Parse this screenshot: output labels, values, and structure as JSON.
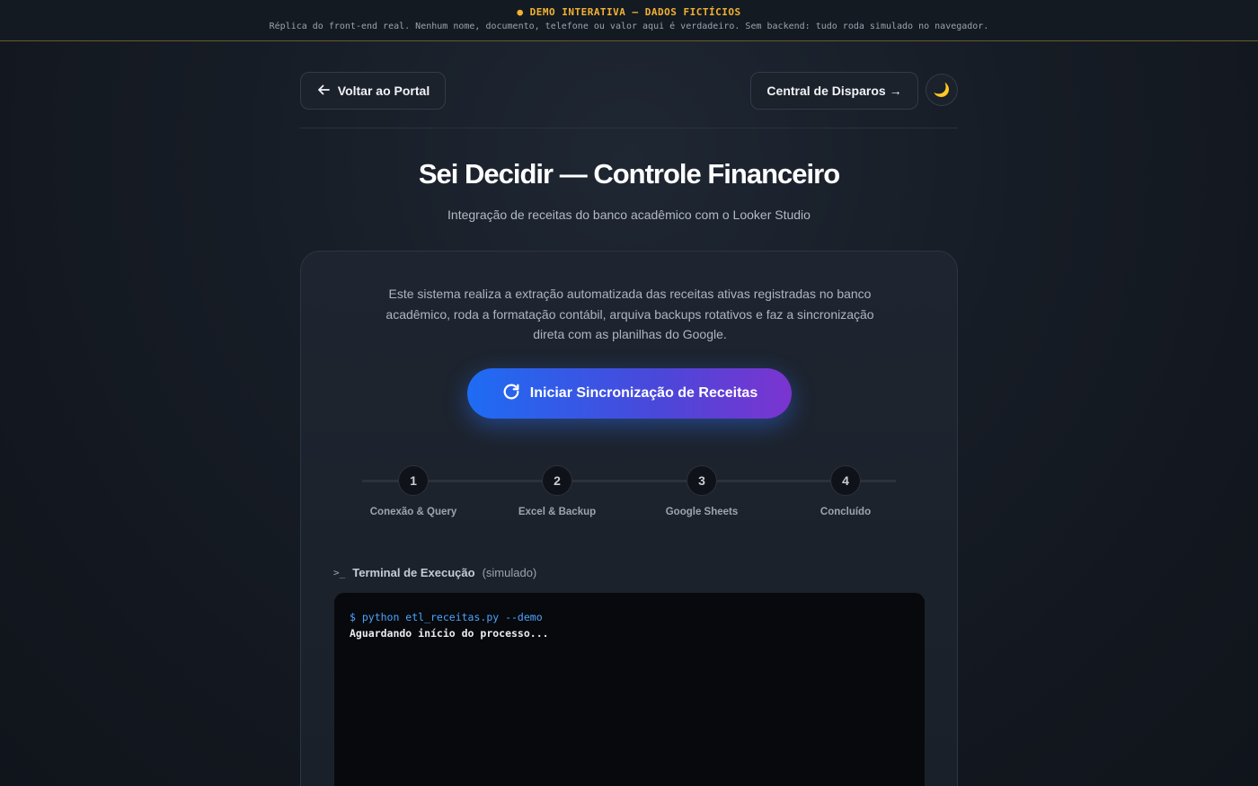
{
  "banner": {
    "title": "● DEMO INTERATIVA — DADOS FICTÍCIOS",
    "subtitle": "Réplica do front-end real. Nenhum nome, documento, telefone ou valor aqui é verdadeiro. Sem backend: tudo roda simulado no navegador."
  },
  "nav": {
    "back_label": "Voltar ao Portal",
    "disparos_label": "Central de Disparos →",
    "theme_icon": "moon-icon",
    "theme_glyph": "🌙"
  },
  "header": {
    "title": "Sei Decidir — Controle Financeiro",
    "subtitle": "Integração de receitas do banco acadêmico com o Looker Studio"
  },
  "card": {
    "description": "Este sistema realiza a extração automatizada das receitas ativas registradas no banco acadêmico, roda a formatação contábil, arquiva backups rotativos e faz a sincronização direta com as planilhas do Google.",
    "sync_button_label": "Iniciar Sincronização de Receitas",
    "steps": [
      {
        "number": "1",
        "label": "Conexão & Query"
      },
      {
        "number": "2",
        "label": "Excel & Backup"
      },
      {
        "number": "3",
        "label": "Google Sheets"
      },
      {
        "number": "4",
        "label": "Concluído"
      }
    ],
    "terminal": {
      "title": "Terminal de Execução",
      "note": "(simulado)",
      "command": "$ python etl_receitas.py --demo",
      "output": "Aguardando início do processo..."
    }
  },
  "colors": {
    "accent_blue": "#1e6cf4",
    "accent_purple": "#7b34d0",
    "banner_yellow": "#f2b233"
  }
}
